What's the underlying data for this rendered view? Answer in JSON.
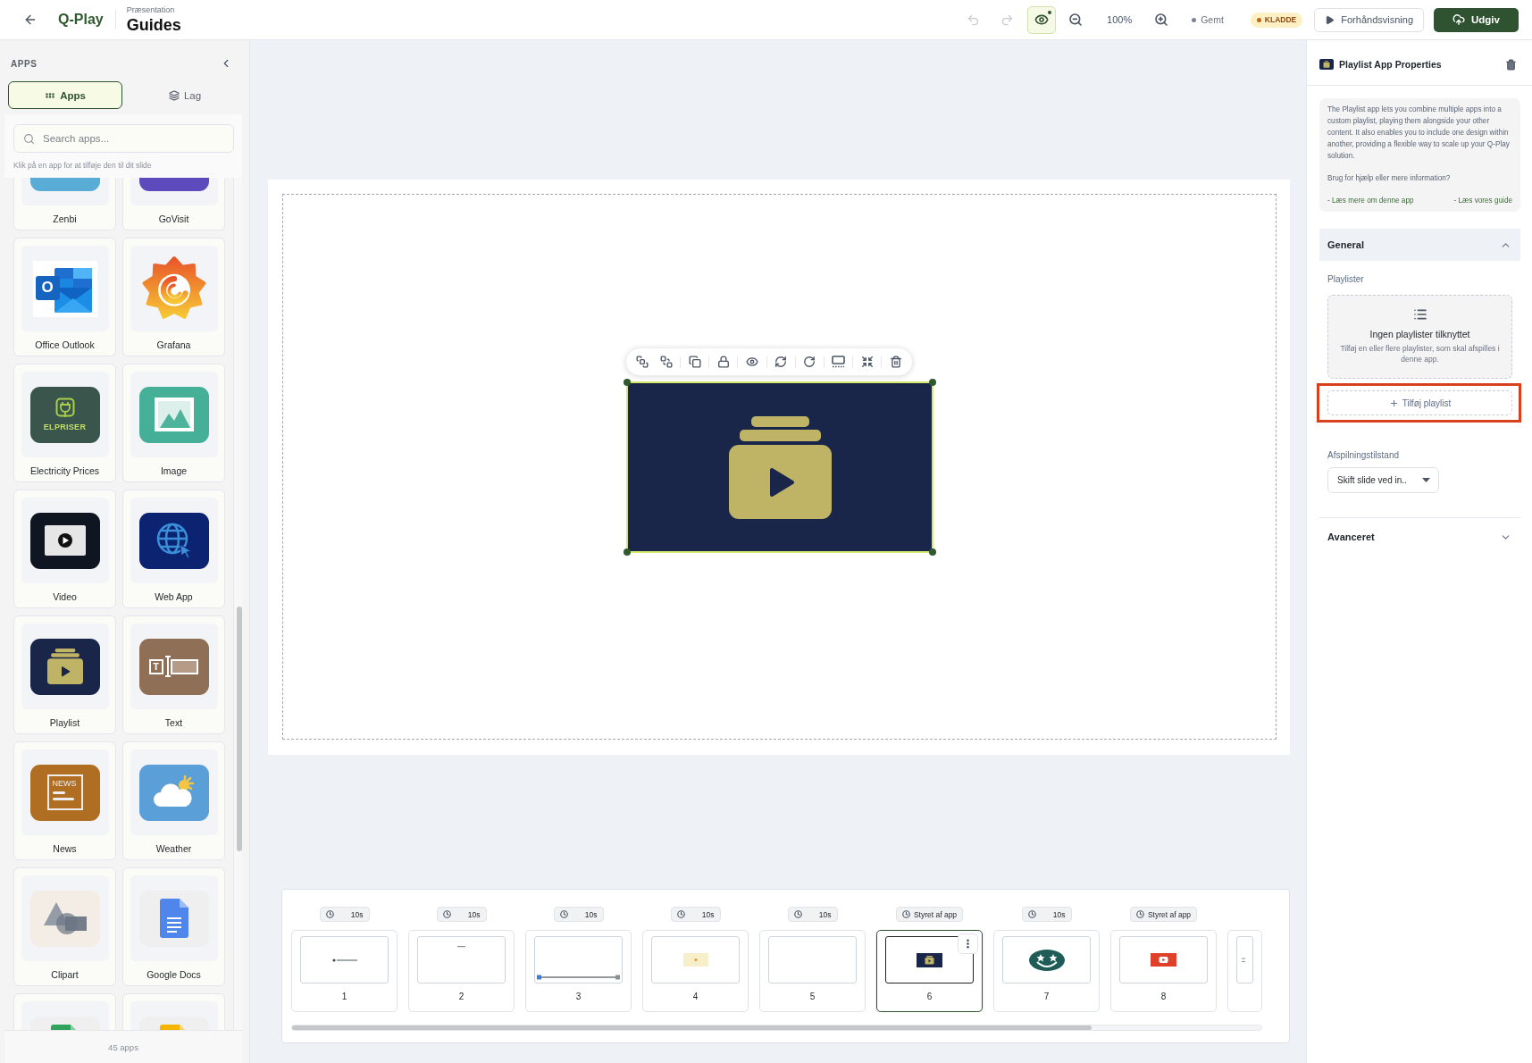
{
  "top_bar": {
    "logo": "Q-Play",
    "breadcrumb": "Præsentation",
    "title": "Guides",
    "undo": {
      "disabled": true
    },
    "redo": {
      "disabled": true
    },
    "preview_toggle": {
      "on": true
    },
    "zoom": "100%",
    "save_status": "Gemt",
    "status_badge": "KLADDE",
    "preview_button": "Forhåndsvisning",
    "publish_button": "Udgiv"
  },
  "sidebar": {
    "heading": "APPS",
    "tabs": [
      {
        "label": "Apps",
        "kind": "apps",
        "selected": true
      },
      {
        "label": "Lag",
        "kind": "layers",
        "selected": false
      }
    ],
    "search": {
      "placeholder": "Search apps..."
    },
    "hint": "Klik på en app for at tilføje den til dit slide",
    "apps": [
      {
        "name": "Zenbi",
        "kind": "zenbi"
      },
      {
        "name": "GoVisit",
        "kind": "govisit"
      },
      {
        "name": "Office Outlook",
        "kind": "outlook",
        "logo_text": "O"
      },
      {
        "name": "Grafana",
        "kind": "grafana"
      },
      {
        "name": "Electricity Prices",
        "kind": "elpriser",
        "logo_text": "ELPRISER"
      },
      {
        "name": "Image",
        "kind": "image"
      },
      {
        "name": "Video",
        "kind": "video"
      },
      {
        "name": "Web App",
        "kind": "webapp"
      },
      {
        "name": "Playlist",
        "kind": "playlist"
      },
      {
        "name": "Text",
        "kind": "text",
        "logo_text": "T"
      },
      {
        "name": "News",
        "kind": "news",
        "logo_text": "NEWS"
      },
      {
        "name": "Weather",
        "kind": "weather"
      },
      {
        "name": "Clipart",
        "kind": "clipart"
      },
      {
        "name": "Google Docs",
        "kind": "docs"
      },
      {
        "kind": "sheets"
      },
      {
        "kind": "slides"
      }
    ],
    "footer": "45 apps"
  },
  "canvas": {
    "element": {
      "kind": "playlist",
      "selected": true
    }
  },
  "filmstrip": {
    "slides": [
      {
        "duration": "10s",
        "kind": "wordmark",
        "number": "1",
        "selected": false
      },
      {
        "duration": "10s",
        "kind": "dash",
        "number": "2",
        "selected": false
      },
      {
        "duration": "10s",
        "kind": "progress",
        "number": "3",
        "selected": false
      },
      {
        "duration": "10s",
        "kind": "banner",
        "number": "4",
        "selected": false
      },
      {
        "duration": "10s",
        "kind": "blank",
        "number": "5",
        "selected": false
      },
      {
        "duration": "Styret af app",
        "kind": "playlist",
        "number": "6",
        "selected": true
      },
      {
        "duration": "10s",
        "kind": "emoji",
        "number": "7",
        "selected": false
      },
      {
        "duration": "Styret af app",
        "kind": "video",
        "number": "8",
        "selected": false
      },
      {
        "kind": "lines",
        "selected": false
      }
    ]
  },
  "properties": {
    "title": "Playlist App Properties",
    "info": {
      "description": "The Playlist app lets you combine multiple apps into a custom playlist, playing them alongside your other content. It also enables you to include one design within another, providing a flexible way to scale up your Q-Play solution.",
      "help": "Brug for hjælp eller mere information?",
      "links": [
        "- Læs mere om denne app",
        "- Læs vores guide"
      ]
    },
    "sections": [
      {
        "title": "General",
        "expanded": true,
        "playlists_label": "Playlister",
        "empty_state": {
          "title": "Ingen playlister tilknyttet",
          "text": "Tilføj en eller flere playlister, som skal afspilles i denne app."
        },
        "add_button": {
          "label": "Tilføj playlist",
          "highlighted": true
        },
        "mode_label": "Afspilningstilstand",
        "mode_select": {
          "value": "Skift slide ved in.."
        }
      },
      {
        "title": "Avanceret",
        "expanded": false
      }
    ]
  }
}
